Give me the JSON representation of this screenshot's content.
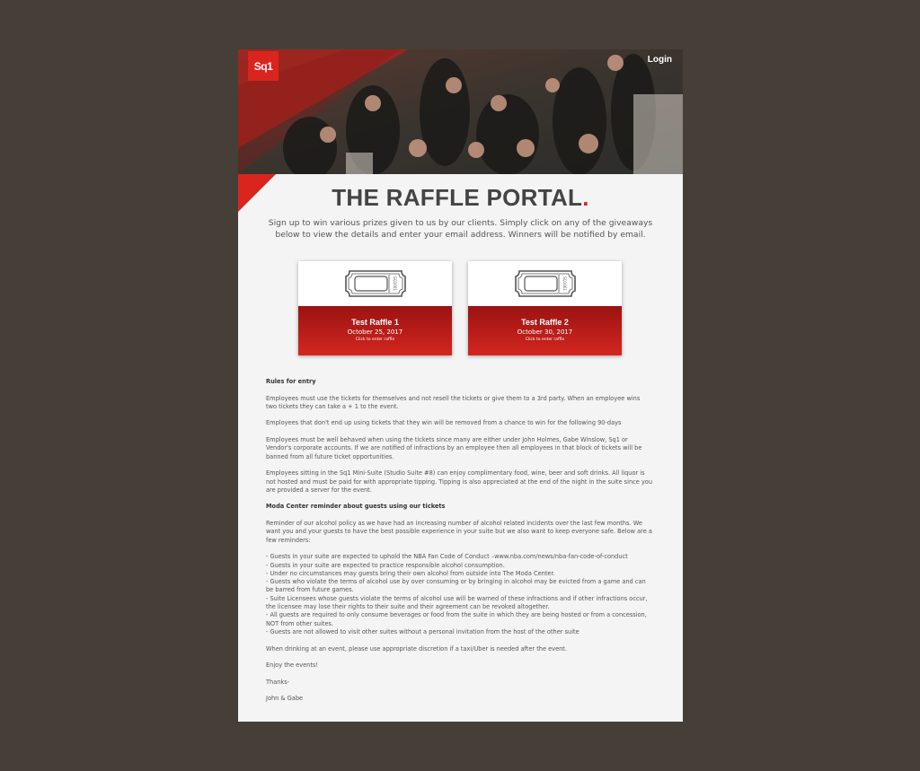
{
  "header": {
    "logo_text": "Sq1",
    "login_label": "Login"
  },
  "title": {
    "text": "THE RAFFLE PORTAL",
    "dot": "."
  },
  "subtitle": "Sign up to win various prizes given to us by our clients. Simply click on any of the giveaways below to view the details and enter your email address. Winners will be notified by email.",
  "raffles": [
    {
      "name": "Test Raffle 1",
      "date": "October 25, 2017",
      "cta": "Click to enter raffle"
    },
    {
      "name": "Test Raffle 2",
      "date": "October 30, 2017",
      "cta": "Click to enter raffle"
    }
  ],
  "ticket_text": "SQ1001",
  "rules": {
    "heading": "Rules for entry",
    "paragraphs": [
      "Employees must use the tickets for themselves and not resell the tickets or give them to a 3rd party.  When an employee wins two tickets they can take a + 1 to the event.",
      "Employees that don't end up using tickets that they win will be removed from a chance to win for the following 90-days",
      "Employees must be well behaved when using the tickets since many are either under John Holmes, Gabe Winslow, Sq1 or Vendor's corporate accounts.  If we are notified of infractions by an employee then all employees in that block of tickets will be banned from all future ticket opportunities.",
      "Employees sitting in the Sq1 Mini-Suite (Studio Suite #8) can enjoy complimentary food, wine, beer and soft drinks.  All liquor is not hosted and must be paid for with appropriate tipping.  Tipping is also appreciated at the end of the night in the suite since you are provided a server for the event."
    ]
  },
  "moda": {
    "heading": "Moda Center reminder about guests using our tickets",
    "intro": "Reminder of our alcohol policy as we have had an increasing number of alcohol related incidents over the last few months. We want you and your guests to have the best possible experience in your suite but we also want to keep everyone safe. Below are a few reminders:",
    "reminders": [
      "- Guests in your suite are expected to uphold the NBA Fan Code of Conduct –www.nba.com/news/nba-fan-code-of-conduct",
      "- Guests in your suite are expected to practice responsible alcohol consumption.",
      "- Under no circumstances may guests bring their own alcohol from outside into The Moda Center.",
      "- Guests who violate the terms of alcohol use by over consuming or by bringing in alcohol may be evicted from a game and can be barred from future games.",
      "- Suite Licensees whose guests violate the terms of alcohol use will be warned of these infractions and if other infractions occur, the licensee may lose their rights to their suite and their agreement can be revoked altogether.",
      "- All guests are required to only consume beverages or food from the suite in which they are being hosted or from a concession, NOT from other suites.",
      "- Guests are not allowed to visit other suites without a personal invitation from the host of the other suite"
    ],
    "discretion": "When drinking at an event, please use appropriate discretion if a taxi/Uber is needed after the event.",
    "enjoy": "Enjoy the events!",
    "thanks": "Thanks-",
    "signoff": "John & Gabe"
  },
  "colors": {
    "brand_red": "#d9251d",
    "background": "#463f38",
    "page": "#f4f4f4"
  }
}
